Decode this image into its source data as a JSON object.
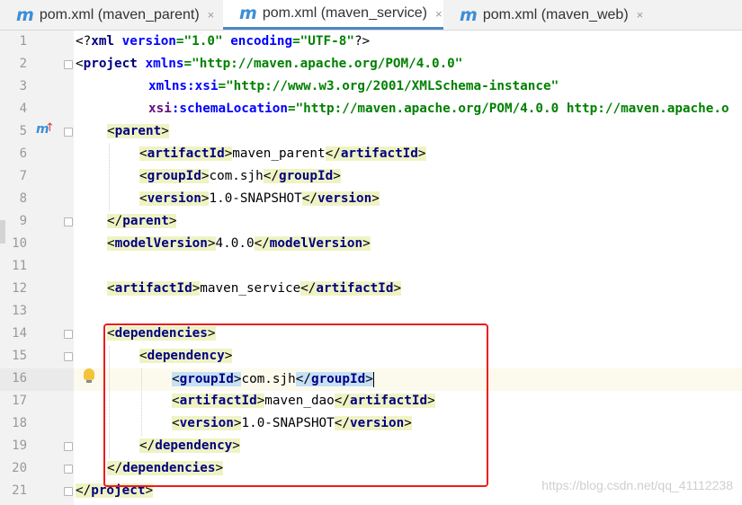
{
  "tabs": [
    {
      "icon": "maven-icon",
      "label": "pom.xml (maven_parent)",
      "active": false
    },
    {
      "icon": "maven-icon",
      "label": "pom.xml (maven_service)",
      "active": true
    },
    {
      "icon": "maven-icon",
      "label": "pom.xml (maven_web)",
      "active": false
    }
  ],
  "tab_close_glyph": "×",
  "gutter": {
    "line_numbers": [
      "1",
      "2",
      "3",
      "4",
      "5",
      "6",
      "7",
      "8",
      "9",
      "10",
      "11",
      "12",
      "13",
      "14",
      "15",
      "16",
      "17",
      "18",
      "19",
      "20",
      "21"
    ],
    "current_line": "16",
    "line5_marker": "m",
    "line5_arrow": "↑"
  },
  "code": {
    "l1": {
      "a": "<?",
      "b": "xml",
      "c": " ",
      "d": "version",
      "e": "=",
      "f": "\"1.0\"",
      "g": " ",
      "h": "encoding",
      "i": "=",
      "j": "\"UTF-8\"",
      "k": "?>"
    },
    "l2": {
      "a": "<",
      "b": "project",
      "c": " ",
      "d": "xmlns",
      "e": "=",
      "f": "\"http://maven.apache.org/POM/4.0.0\""
    },
    "l3": {
      "a": "xmlns:xsi",
      "b": "=",
      "c": "\"http://www.w3.org/2001/XMLSchema-instance\""
    },
    "l4": {
      "a": "xsi",
      "b": ":schemaLocation",
      "c": "=",
      "d": "\"http://maven.apache.org/POM/4.0.0 http://maven.apache.o"
    },
    "l5": {
      "a": "<",
      "b": "parent",
      "c": ">"
    },
    "l6": {
      "a": "<",
      "b": "artifactId",
      "c": ">",
      "d": "maven_parent",
      "e": "</",
      "f": "artifactId",
      "g": ">"
    },
    "l7": {
      "a": "<",
      "b": "groupId",
      "c": ">",
      "d": "com.sjh",
      "e": "</",
      "f": "groupId",
      "g": ">"
    },
    "l8": {
      "a": "<",
      "b": "version",
      "c": ">",
      "d": "1.0-SNAPSHOT",
      "e": "</",
      "f": "version",
      "g": ">"
    },
    "l9": {
      "a": "</",
      "b": "parent",
      "c": ">"
    },
    "l10": {
      "a": "<",
      "b": "modelVersion",
      "c": ">",
      "d": "4.0.0",
      "e": "</",
      "f": "modelVersion",
      "g": ">"
    },
    "l12": {
      "a": "<",
      "b": "artifactId",
      "c": ">",
      "d": "maven_service",
      "e": "</",
      "f": "artifactId",
      "g": ">"
    },
    "l14": {
      "a": "<",
      "b": "dependencies",
      "c": ">"
    },
    "l15": {
      "a": "<",
      "b": "dependency",
      "c": ">"
    },
    "l16": {
      "a": "<",
      "b": "groupId",
      "c": ">",
      "d": "com.sjh",
      "e": "</",
      "f": "groupId",
      "g": ">"
    },
    "l17": {
      "a": "<",
      "b": "artifactId",
      "c": ">",
      "d": "maven_dao",
      "e": "</",
      "f": "artifactId",
      "g": ">"
    },
    "l18": {
      "a": "<",
      "b": "version",
      "c": ">",
      "d": "1.0-SNAPSHOT",
      "e": "</",
      "f": "version",
      "g": ">"
    },
    "l19": {
      "a": "</",
      "b": "dependency",
      "c": ">"
    },
    "l20": {
      "a": "</",
      "b": "dependencies",
      "c": ">"
    },
    "l21": {
      "a": "</",
      "b": "project",
      "c": ">"
    }
  },
  "watermark": "https://blog.csdn.net/qq_41112238",
  "colors": {
    "tag": "#000080",
    "attr": "#0000ff",
    "value": "#008000",
    "namespace": "#660e7a",
    "annotation_box": "#ee1b1b",
    "tab_accent": "#4a88c7"
  }
}
